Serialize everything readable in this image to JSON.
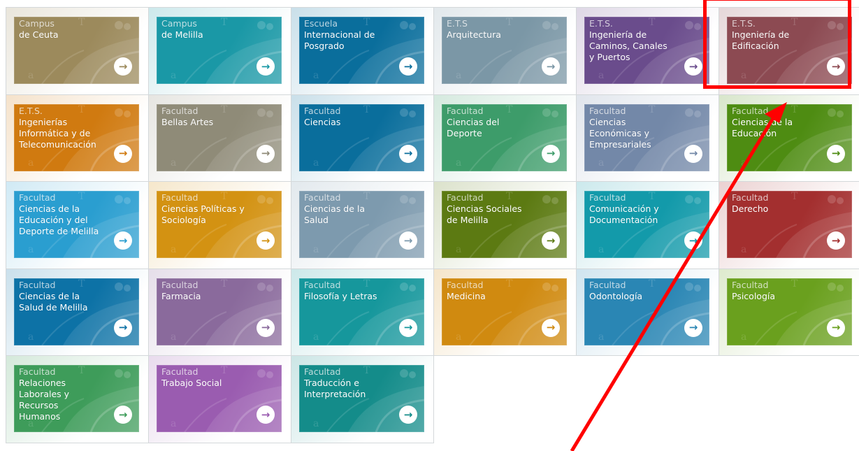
{
  "tiles": [
    {
      "kind": "Campus",
      "name": "de Ceuta",
      "color": "#9c8a5c"
    },
    {
      "kind": "Campus",
      "name": "de Melilla",
      "color": "#1a98a6"
    },
    {
      "kind": "Escuela",
      "name": "Internacional de\nPosgrado",
      "color": "#0a6e9c"
    },
    {
      "kind": "E.T.S",
      "name": "Arquitectura",
      "color": "#7b97a6"
    },
    {
      "kind": "E.T.S.",
      "name": "Ingeniería de\nCaminos, Canales\ny Puertos",
      "color": "#6a4c8c"
    },
    {
      "kind": "E.T.S.",
      "name": "Ingeniería de\nEdificación",
      "color": "#8c4a52"
    },
    {
      "kind": "E.T.S.",
      "name": "Ingenierías\nInformática y de\nTelecomunicación",
      "color": "#d07a10"
    },
    {
      "kind": "Facultad",
      "name": "Bellas Artes",
      "color": "#8f8b78"
    },
    {
      "kind": "Facultad",
      "name": "Ciencias",
      "color": "#0a6e9c"
    },
    {
      "kind": "Facultad",
      "name": "Ciencias del\nDeporte",
      "color": "#3d9c6a"
    },
    {
      "kind": "Facultad",
      "name": "Ciencias\nEconómicas y\nEmpresariales",
      "color": "#7388a8"
    },
    {
      "kind": "Facultad",
      "name": "Ciencias de la\nEducación",
      "color": "#4e8c12"
    },
    {
      "kind": "Facultad",
      "name": "Ciencias de la\nEducación y del\nDeporte de Melilla",
      "color": "#2a9ed0"
    },
    {
      "kind": "Facultad",
      "name": "Ciencias Políticas y\nSociología",
      "color": "#d39212"
    },
    {
      "kind": "Facultad",
      "name": "Ciencias de la\nSalud",
      "color": "#7d9aae"
    },
    {
      "kind": "Facultad",
      "name": "Ciencias Sociales\nde Melilla",
      "color": "#5c7a12"
    },
    {
      "kind": "Facultad",
      "name": "Comunicación y\nDocumentación",
      "color": "#139aaa"
    },
    {
      "kind": "Facultad",
      "name": "Derecho",
      "color": "#a32f2f"
    },
    {
      "kind": "Facultad",
      "name": "Ciencias de la\nSalud de Melilla",
      "color": "#0d72a6"
    },
    {
      "kind": "Facultad",
      "name": "Farmacia",
      "color": "#8a6a9c"
    },
    {
      "kind": "Facultad",
      "name": "Filosofía y Letras",
      "color": "#16979c"
    },
    {
      "kind": "Facultad",
      "name": "Medicina",
      "color": "#d08a10"
    },
    {
      "kind": "Facultad",
      "name": "Odontología",
      "color": "#2a86b4"
    },
    {
      "kind": "Facultad",
      "name": "Psicología",
      "color": "#6aa01e"
    },
    {
      "kind": "Facultad",
      "name": "Relaciones\nLaborales y\nRecursos\nHumanos",
      "color": "#3e9c5a"
    },
    {
      "kind": "Facultad",
      "name": "Trabajo Social",
      "color": "#9a5cb0"
    },
    {
      "kind": "Facultad",
      "name": "Traducción e\nInterpretación",
      "color": "#148c8a"
    }
  ],
  "arrow_glyph": "→",
  "annotation": {
    "highlight_color": "#ff0000"
  }
}
